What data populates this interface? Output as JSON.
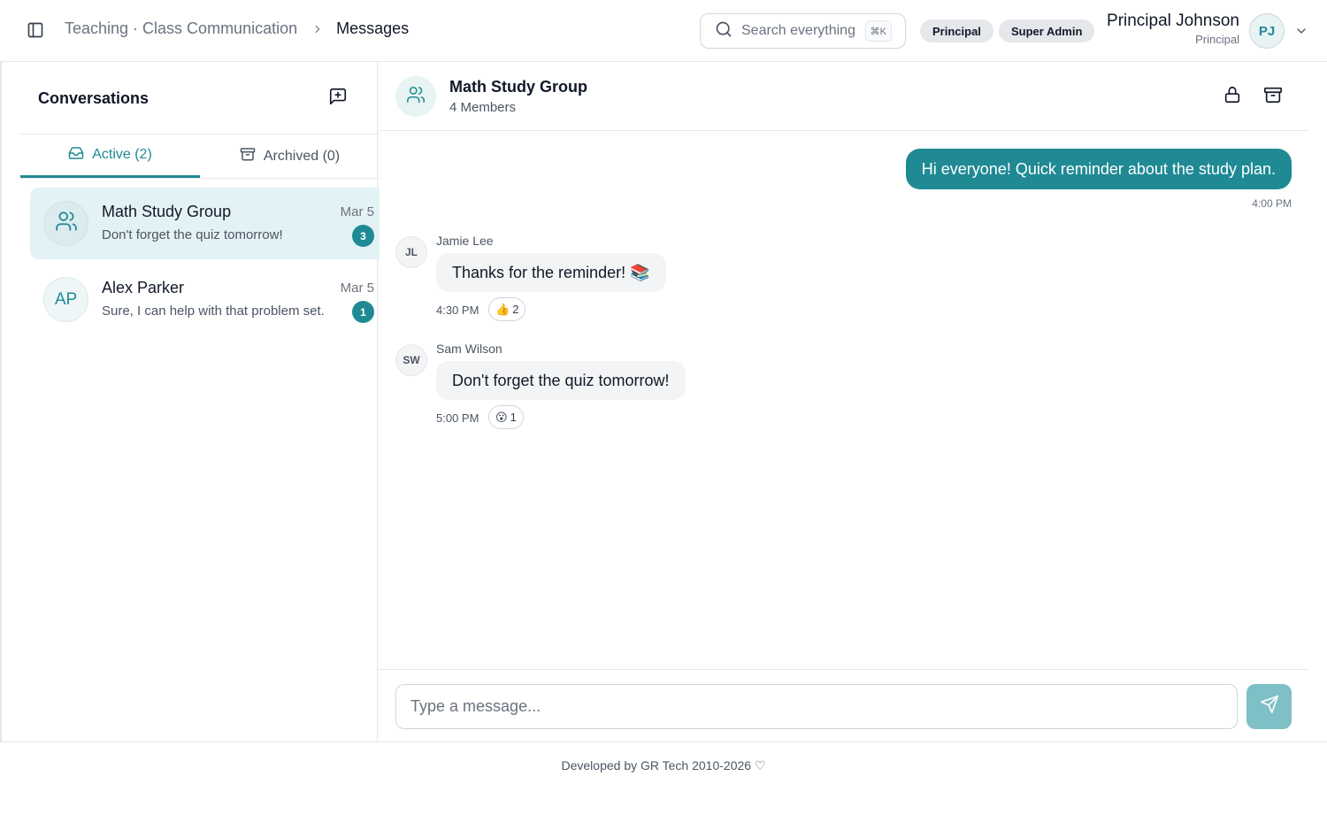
{
  "header": {
    "breadcrumb_parent": "Teaching · Class Communication",
    "breadcrumb_current": "Messages",
    "search_placeholder": "Search everything",
    "search_shortcut": "⌘K",
    "badges": [
      "Principal",
      "Super Admin"
    ],
    "user_name": "Principal Johnson",
    "user_role": "Principal",
    "user_initials": "PJ"
  },
  "sidebar": {
    "title": "Conversations",
    "tabs": [
      {
        "label": "Active (2)",
        "icon": "inbox-icon",
        "active": true
      },
      {
        "label": "Archived (0)",
        "icon": "archive-icon",
        "active": false
      }
    ],
    "conversations": [
      {
        "name": "Math Study Group",
        "date": "Mar 5",
        "preview": "Don't forget the quiz tomorrow!",
        "unread": "3",
        "avatar": "users-icon",
        "selected": true
      },
      {
        "name": "Alex Parker",
        "date": "Mar 5",
        "preview": "Sure, I can help with that problem set.",
        "unread": "1",
        "initials": "AP",
        "selected": false
      }
    ]
  },
  "chat": {
    "title": "Math Study Group",
    "members": "4 Members",
    "messages": [
      {
        "own": true,
        "text": "Hi everyone! Quick reminder about the study plan.",
        "time": "4:00 PM"
      },
      {
        "own": false,
        "initials": "JL",
        "sender": "Jamie Lee",
        "text": "Thanks for the reminder! 📚",
        "time": "4:30 PM",
        "reaction_emoji": "👍",
        "reaction_count": "2"
      },
      {
        "own": false,
        "initials": "SW",
        "sender": "Sam Wilson",
        "text": "Don't forget the quiz tomorrow!",
        "time": "5:00 PM",
        "reaction_emoji": "😮",
        "reaction_count": "1"
      }
    ],
    "input_placeholder": "Type a message..."
  },
  "footer": {
    "text": "Developed by GR Tech 2010-2026 ♡"
  },
  "colors": {
    "accent": "#1f8a94",
    "accent_light": "#e3f2f4",
    "send_disabled": "#7fbfc6"
  }
}
